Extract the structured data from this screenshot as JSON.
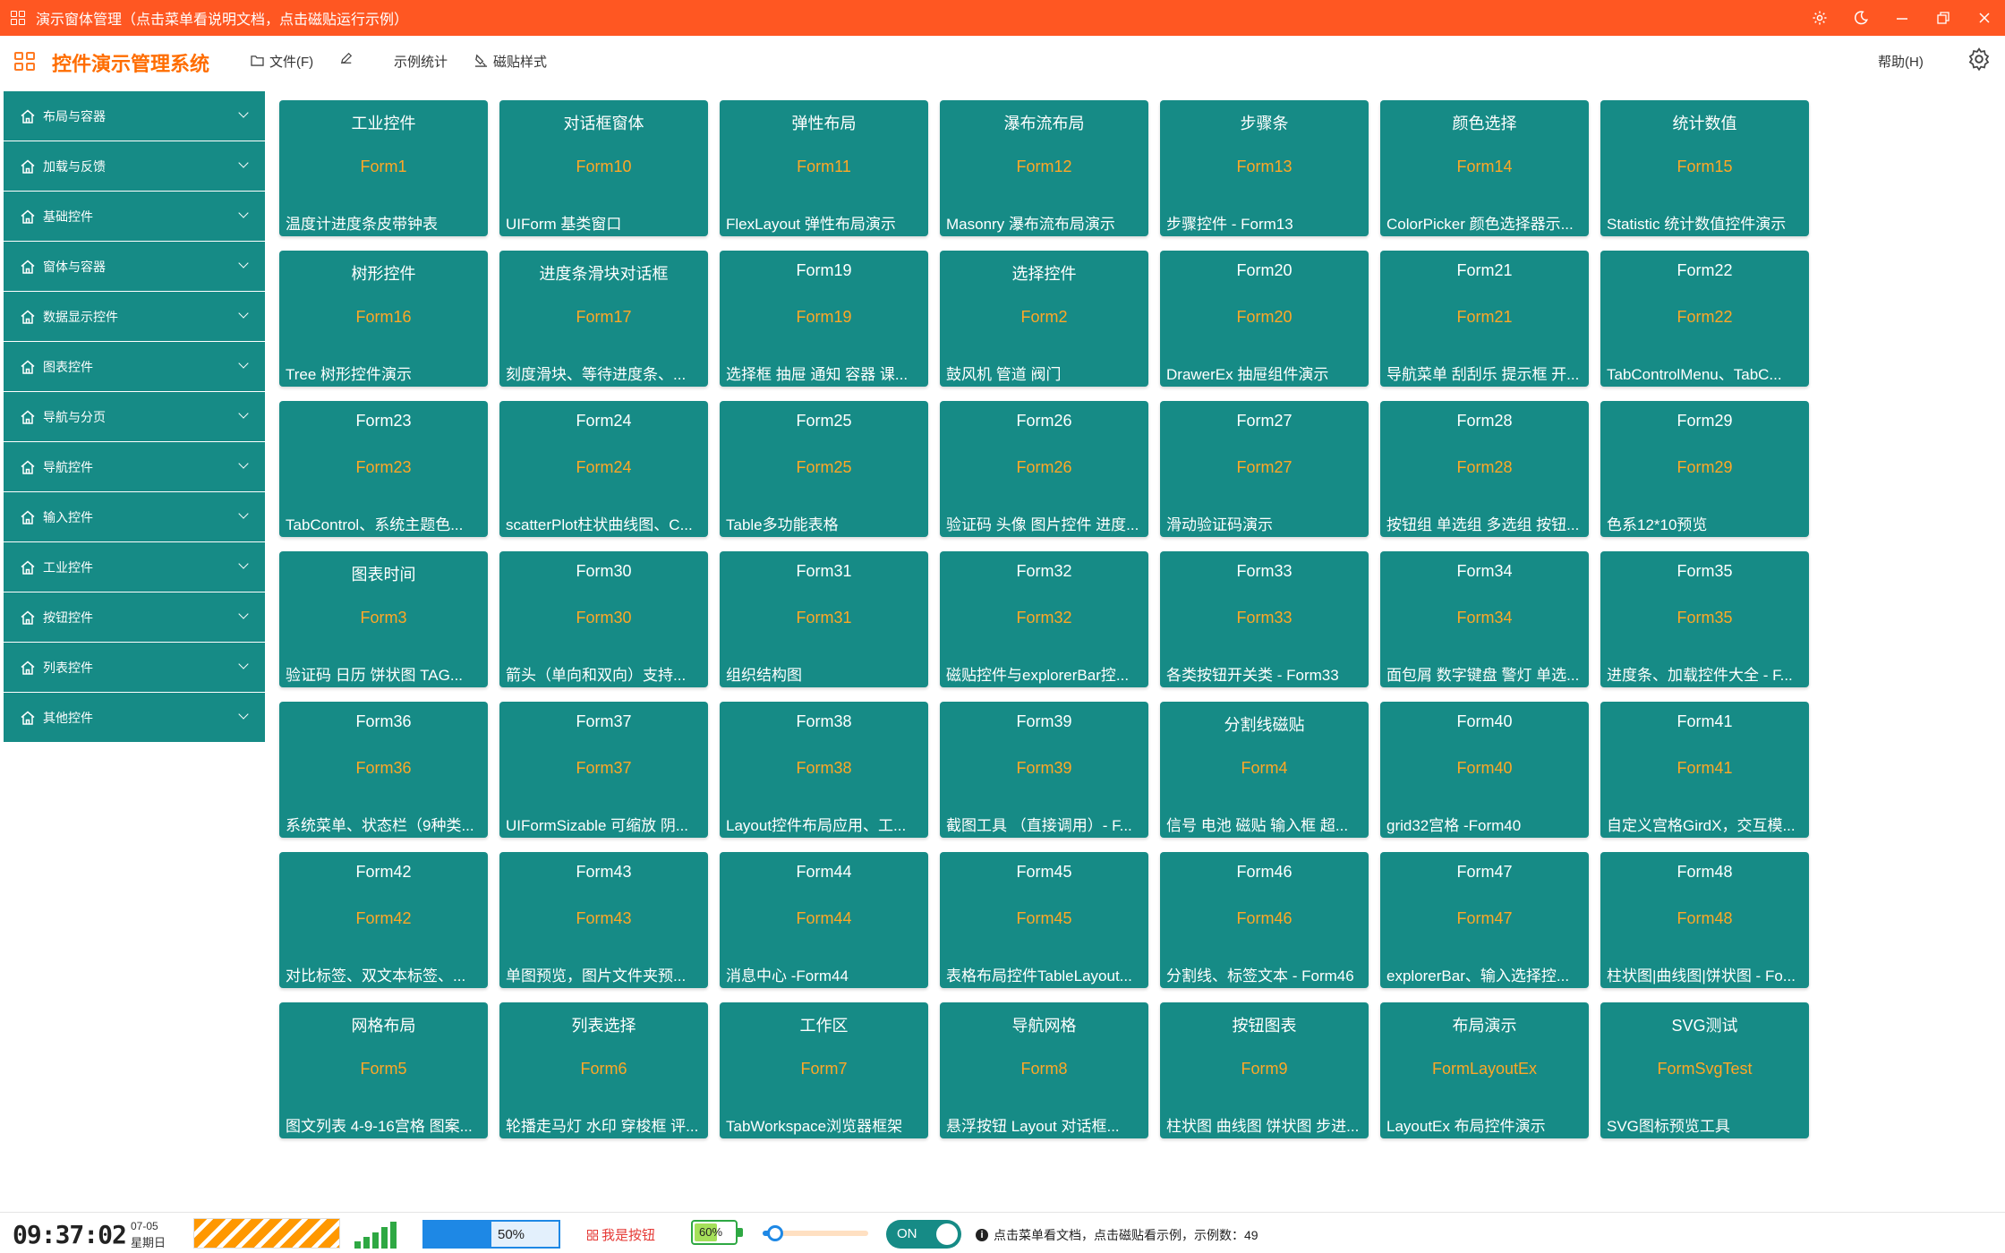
{
  "titlebar": {
    "title": "演示窗体管理（点击菜单看说明文档，点击磁贴运行示例）",
    "icons": [
      "grid-icon",
      "gear-icon",
      "theme-icon",
      "minimize-icon",
      "restore-icon",
      "close-icon"
    ]
  },
  "menubar": {
    "app_name": "控件演示管理系统",
    "file_menu": "文件(F)",
    "edit_icon": "pencil-icon",
    "stats_menu": "示例统计",
    "tile_style_menu": "磁贴样式",
    "help_menu": "帮助(H)"
  },
  "sidebar": {
    "items": [
      {
        "label": "布局与容器"
      },
      {
        "label": "加载与反馈"
      },
      {
        "label": "基础控件"
      },
      {
        "label": "窗体与容器"
      },
      {
        "label": "数据显示控件"
      },
      {
        "label": "图表控件"
      },
      {
        "label": "导航与分页"
      },
      {
        "label": "导航控件"
      },
      {
        "label": "输入控件"
      },
      {
        "label": "工业控件"
      },
      {
        "label": "按钮控件"
      },
      {
        "label": "列表控件"
      },
      {
        "label": "其他控件"
      }
    ]
  },
  "tiles": [
    {
      "title": "工业控件",
      "form": "Form1",
      "desc": "温度计进度条皮带钟表"
    },
    {
      "title": "对话框窗体",
      "form": "Form10",
      "desc": "UIForm 基类窗口"
    },
    {
      "title": "弹性布局",
      "form": "Form11",
      "desc": "FlexLayout 弹性布局演示"
    },
    {
      "title": "瀑布流布局",
      "form": "Form12",
      "desc": "Masonry 瀑布流布局演示"
    },
    {
      "title": "步骤条",
      "form": "Form13",
      "desc": "步骤控件  - Form13"
    },
    {
      "title": "颜色选择",
      "form": "Form14",
      "desc": "ColorPicker 颜色选择器示..."
    },
    {
      "title": "统计数值",
      "form": "Form15",
      "desc": "Statistic 统计数值控件演示"
    },
    {
      "title": "树形控件",
      "form": "Form16",
      "desc": "Tree 树形控件演示"
    },
    {
      "title": "进度条滑块对话框",
      "form": "Form17",
      "desc": "刻度滑块、等待进度条、..."
    },
    {
      "title": "Form19",
      "form": "Form19",
      "desc": "选择框 抽屉 通知 容器 课..."
    },
    {
      "title": "选择控件",
      "form": "Form2",
      "desc": "鼓风机 管道 阀门"
    },
    {
      "title": "Form20",
      "form": "Form20",
      "desc": "DrawerEx 抽屉组件演示"
    },
    {
      "title": "Form21",
      "form": "Form21",
      "desc": "导航菜单 刮刮乐 提示框 开..."
    },
    {
      "title": "Form22",
      "form": "Form22",
      "desc": "TabControlMenu、TabC..."
    },
    {
      "title": "Form23",
      "form": "Form23",
      "desc": "TabControl、系统主题色..."
    },
    {
      "title": "Form24",
      "form": "Form24",
      "desc": "scatterPlot柱状曲线图、C..."
    },
    {
      "title": "Form25",
      "form": "Form25",
      "desc": "Table多功能表格"
    },
    {
      "title": "Form26",
      "form": "Form26",
      "desc": "验证码 头像 图片控件 进度..."
    },
    {
      "title": "Form27",
      "form": "Form27",
      "desc": "滑动验证码演示"
    },
    {
      "title": "Form28",
      "form": "Form28",
      "desc": "按钮组 单选组 多选组 按钮..."
    },
    {
      "title": "Form29",
      "form": "Form29",
      "desc": "色系12*10预览"
    },
    {
      "title": "图表时间",
      "form": "Form3",
      "desc": "验证码 日历 饼状图 TAG..."
    },
    {
      "title": "Form30",
      "form": "Form30",
      "desc": "箭头（单向和双向）支持..."
    },
    {
      "title": "Form31",
      "form": "Form31",
      "desc": "组织结构图"
    },
    {
      "title": "Form32",
      "form": "Form32",
      "desc": "磁贴控件与explorerBar控..."
    },
    {
      "title": "Form33",
      "form": "Form33",
      "desc": "各类按钮开关类 - Form33"
    },
    {
      "title": "Form34",
      "form": "Form34",
      "desc": "面包屑 数字键盘 警灯 单选..."
    },
    {
      "title": "Form35",
      "form": "Form35",
      "desc": "进度条、加载控件大全 - F..."
    },
    {
      "title": "Form36",
      "form": "Form36",
      "desc": "系统菜单、状态栏（9种类..."
    },
    {
      "title": "Form37",
      "form": "Form37",
      "desc": "UIFormSizable 可缩放 阴..."
    },
    {
      "title": "Form38",
      "form": "Form38",
      "desc": "Layout控件布局应用、工..."
    },
    {
      "title": "Form39",
      "form": "Form39",
      "desc": "截图工具 （直接调用）- F..."
    },
    {
      "title": "分割线磁贴",
      "form": "Form4",
      "desc": "信号 电池 磁贴 输入框 超..."
    },
    {
      "title": "Form40",
      "form": "Form40",
      "desc": "grid32宫格 -Form40"
    },
    {
      "title": "Form41",
      "form": "Form41",
      "desc": "自定义宫格GirdX，交互模..."
    },
    {
      "title": "Form42",
      "form": "Form42",
      "desc": "对比标签、双文本标签、..."
    },
    {
      "title": "Form43",
      "form": "Form43",
      "desc": "单图预览，图片文件夹预..."
    },
    {
      "title": "Form44",
      "form": "Form44",
      "desc": "消息中心  -Form44"
    },
    {
      "title": "Form45",
      "form": "Form45",
      "desc": "表格布局控件TableLayout..."
    },
    {
      "title": "Form46",
      "form": "Form46",
      "desc": "分割线、标签文本 - Form46"
    },
    {
      "title": "Form47",
      "form": "Form47",
      "desc": "explorerBar、输入选择控..."
    },
    {
      "title": "Form48",
      "form": "Form48",
      "desc": "柱状图|曲线图|饼状图 - Fo..."
    },
    {
      "title": "网格布局",
      "form": "Form5",
      "desc": "图文列表 4-9-16宫格 图案..."
    },
    {
      "title": "列表选择",
      "form": "Form6",
      "desc": "轮播走马灯 水印 穿梭框 评..."
    },
    {
      "title": "工作区",
      "form": "Form7",
      "desc": "TabWorkspace浏览器框架"
    },
    {
      "title": "导航网格",
      "form": "Form8",
      "desc": "悬浮按钮 Layout 对话框..."
    },
    {
      "title": "按钮图表",
      "form": "Form9",
      "desc": "柱状图 曲线图 饼状图 步进..."
    },
    {
      "title": "布局演示",
      "form": "FormLayoutEx",
      "desc": "LayoutEx 布局控件演示"
    },
    {
      "title": "SVG测试",
      "form": "FormSvgTest",
      "desc": "SVG图标预览工具"
    }
  ],
  "statusbar": {
    "time": "09:37:02",
    "date": "07-05",
    "weekday": "星期日",
    "progress_text": "50%",
    "progress_value": 0.5,
    "signal_level": 5,
    "red_button_label": "我是按钮",
    "battery_text": "60%",
    "battery_value": 0.6,
    "slider_value": 0.12,
    "toggle_label": "ON",
    "message": "点击菜单看文档，点击磁贴看示例，示例数：49"
  },
  "colors": {
    "accent": "#ff5722",
    "tile_bg": "#168b86",
    "form_text": "#ffa726",
    "brand_text": "#ff6d00"
  }
}
